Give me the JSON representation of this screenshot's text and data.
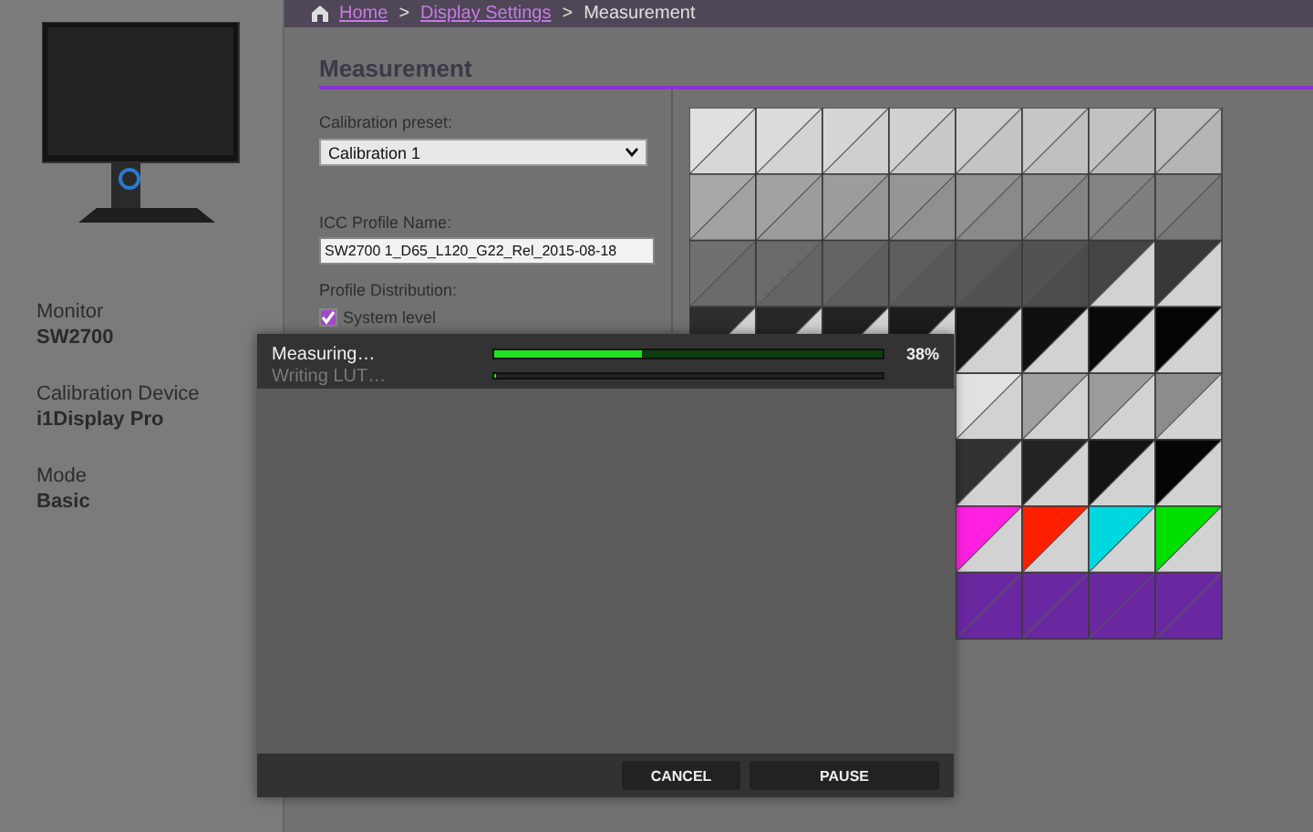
{
  "breadcrumb": [
    {
      "label": "Home",
      "kind": "link"
    },
    {
      "label": ">",
      "kind": "separator"
    },
    {
      "label": "Display Settings",
      "kind": "link"
    },
    {
      "label": ">",
      "kind": "separator"
    },
    {
      "label": "Measurement",
      "kind": "current"
    }
  ],
  "sidebar": {
    "info": [
      {
        "label": "Monitor",
        "value": "SW2700"
      },
      {
        "label": "Calibration Device",
        "value": "i1Display Pro"
      },
      {
        "label": "Mode",
        "value": "Basic"
      }
    ]
  },
  "section_title": "Measurement",
  "form": {
    "preset_label": "Calibration preset:",
    "preset_value": "Calibration 1",
    "icc_label": "ICC Profile Name:",
    "icc_value": "SW2700 1_D65_L120_G22_Rel_2015-08-18",
    "distribution_label": "Profile Distribution:",
    "distribution_options": [
      {
        "label": "System level",
        "checked": true
      }
    ]
  },
  "dialog": {
    "progress": [
      {
        "label": "Measuring…",
        "active": true,
        "level": 0.38,
        "reading": "38%"
      },
      {
        "label": "Writing LUT…",
        "active": false,
        "level": 0
      }
    ],
    "buttons": [
      {
        "label": "CANCEL"
      },
      {
        "label": "PAUSE"
      }
    ]
  }
}
